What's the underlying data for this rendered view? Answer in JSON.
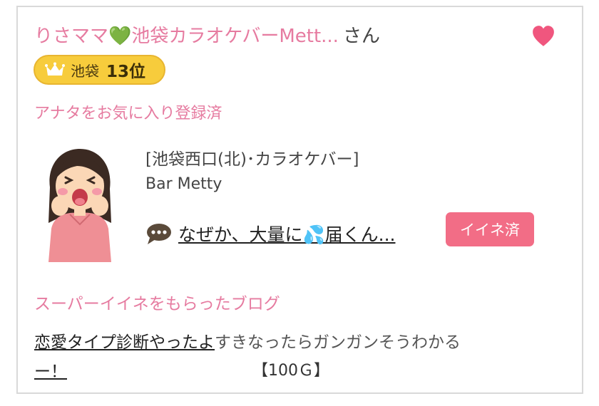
{
  "profile": {
    "name": "りさママ💚池袋カラオケバーMett...",
    "suffix": "さん",
    "area": "池袋",
    "rank": "13位",
    "favorite_status": "アナタをお気に入り登録済"
  },
  "shop": {
    "category": "[池袋西口(北)･カラオケバー]",
    "name": "Bar Metty"
  },
  "latest_blog": {
    "title": "なぜか、大量に💦届くん..."
  },
  "iine_button": "イイネ済",
  "super_iine": {
    "heading": "スーパーイイネをもらったブログ",
    "link_line1": "恋愛タイプ診断やったよ",
    "continuation": "すきなったらガンガンそうわかる",
    "link_line2": "ー！",
    "points": "【100Ｇ】"
  },
  "icons": [
    "heart-icon",
    "crown-icon",
    "speech-bubble-icon",
    "woman-avatar-icon"
  ],
  "colors": {
    "accent_pink": "#e67ba0",
    "button_pink": "#f26d86",
    "rank_gold": "#f7cc3c",
    "heart": "#f0567e"
  }
}
